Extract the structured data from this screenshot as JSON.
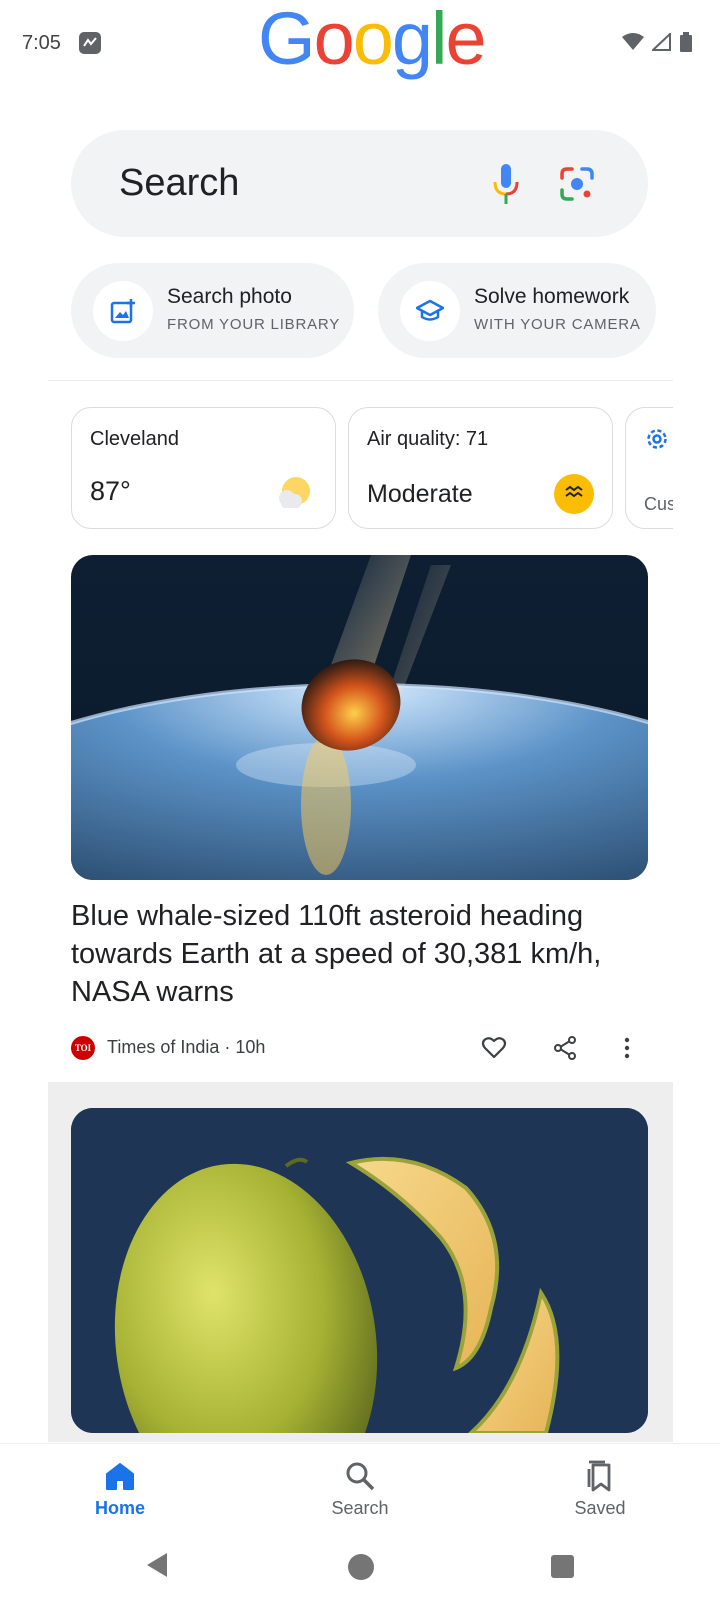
{
  "status_bar": {
    "time": "7:05",
    "app_icon": "activity-icon",
    "icons": [
      "wifi-icon",
      "signal-icon",
      "battery-icon"
    ]
  },
  "logo": {
    "letters": [
      "G",
      "o",
      "o",
      "g",
      "l",
      "e"
    ],
    "colors": [
      "#4285F4",
      "#EA4335",
      "#FBBC05",
      "#4285F4",
      "#34A853",
      "#EA4335"
    ]
  },
  "search": {
    "placeholder": "Search",
    "icons": [
      "mic-icon",
      "lens-icon"
    ]
  },
  "chips": [
    {
      "title": "Search photo",
      "subtitle": "FROM YOUR LIBRARY",
      "icon": "add-photo-icon"
    },
    {
      "title": "Solve homework",
      "subtitle": "WITH YOUR CAMERA",
      "icon": "graduation-cap-icon"
    }
  ],
  "cards": {
    "weather": {
      "location": "Cleveland",
      "temperature": "87°",
      "icon": "partly-sunny-icon"
    },
    "air_quality": {
      "label": "Air quality: 71",
      "level": "Moderate",
      "icon": "wind-icon"
    },
    "customize": {
      "label": "Cus",
      "icon": "gear-icon"
    }
  },
  "article_1": {
    "title": "Blue whale-sized 110ft asteroid heading towards Earth at a speed of 30,381 km/h, NASA warns",
    "source_logo": "TOI",
    "source": "Times of India · 10h",
    "actions": [
      "heart-icon",
      "share-icon",
      "more-vert-icon"
    ]
  },
  "article_2": {
    "image": "melon-image"
  },
  "bottom_nav": {
    "items": [
      {
        "label": "Home",
        "icon": "home-icon",
        "active": true
      },
      {
        "label": "Search",
        "icon": "search-icon",
        "active": false
      },
      {
        "label": "Saved",
        "icon": "bookmarks-icon",
        "active": false
      }
    ]
  },
  "colors": {
    "accent": "#1a73e8",
    "chip_bg": "#f1f3f4",
    "aq_badge": "#fbbc04"
  }
}
